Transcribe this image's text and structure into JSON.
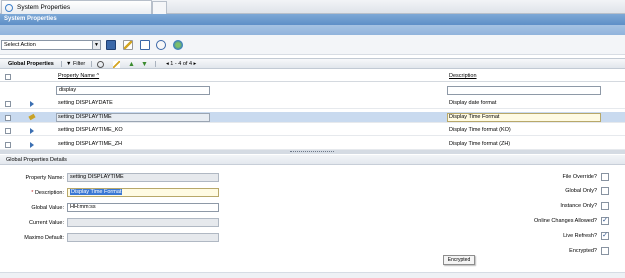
{
  "tabs": {
    "active": "System Properties"
  },
  "app": {
    "title": "System Properties"
  },
  "toolbar": {
    "select_action": "Select Action"
  },
  "table": {
    "title": "Global Properties",
    "filter_label": "Filter",
    "pager": "1 - 4 of 4",
    "columns": [
      "Property Name",
      "Description"
    ],
    "filter_value": "display",
    "rows": [
      {
        "name": "setting DISPLAYDATE",
        "description": "Display date format"
      },
      {
        "name": "setting DISPLAYTIME",
        "description": "Display Time Format"
      },
      {
        "name": "setting DISPLAYTIME_KO",
        "description": "Display Time format (KO)"
      },
      {
        "name": "setting DISPLAYTIME_ZH",
        "description": "Display Time format (ZH)"
      }
    ]
  },
  "details": {
    "title": "Global Properties Details",
    "property_name_label": "Property Name:",
    "property_name": "setting DISPLAYTIME",
    "description_label": "Description:",
    "description": "Display Time Format",
    "global_value_label": "Global Value:",
    "global_value": "HH:mm:ss",
    "current_value_label": "Current Value:",
    "maximo_default_label": "Maximo Default:",
    "checks": [
      {
        "label": "File Override?",
        "checked": false
      },
      {
        "label": "Global Only?",
        "checked": false
      },
      {
        "label": "Instance Only?",
        "checked": false
      },
      {
        "label": "Online Changes Allowed?",
        "checked": true
      },
      {
        "label": "Live Refresh?",
        "checked": true
      },
      {
        "label": "Encrypted?",
        "checked": false
      }
    ],
    "tooltip": "Encrypted"
  },
  "colors": {
    "title_bar": "#6a98cc",
    "selected_row": "#c9daef",
    "accent": "#3b6fb2"
  }
}
